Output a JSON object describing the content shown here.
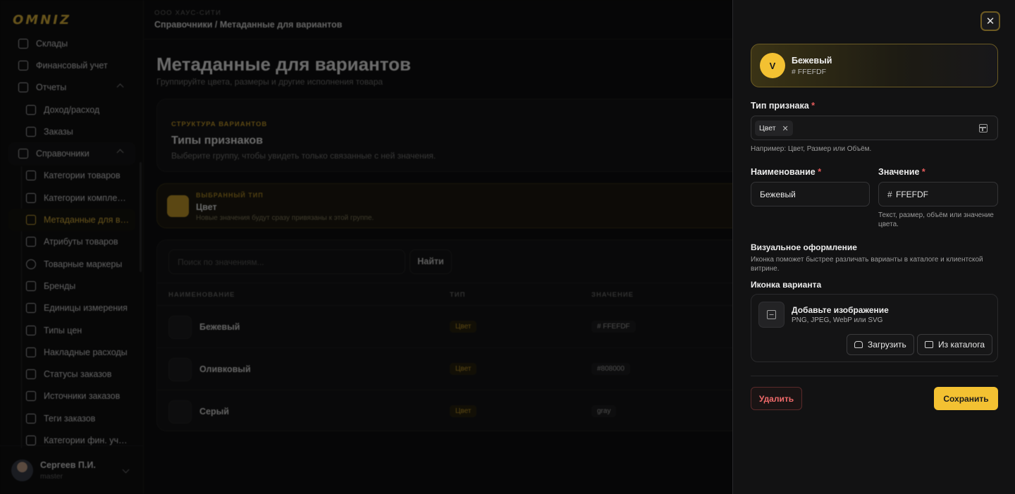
{
  "app": {
    "logo": "OMNIZ",
    "company": "ООО ХАУС-СИТИ",
    "breadcrumb": "Справочники / Метаданные для вариантов"
  },
  "sidebar": {
    "items": [
      {
        "label": "Склады",
        "icon": "warehouse-icon"
      },
      {
        "label": "Финансовый учет",
        "icon": "finance-icon"
      },
      {
        "label": "Отчеты",
        "icon": "reports-icon"
      },
      {
        "label": "Доход/расход",
        "icon": "bank-icon"
      },
      {
        "label": "Заказы",
        "icon": "box-icon"
      },
      {
        "label": "Справочники",
        "icon": "book-icon"
      },
      {
        "label": "Категории товаров",
        "icon": "tree-icon"
      },
      {
        "label": "Категории компле…",
        "icon": "hierarchy-icon"
      },
      {
        "label": "Метаданные для в…",
        "icon": "sliders-icon"
      },
      {
        "label": "Атрибуты товаров",
        "icon": "document-icon"
      },
      {
        "label": "Товарные маркеры",
        "icon": "circle-icon"
      },
      {
        "label": "Бренды",
        "icon": "bookmark-icon"
      },
      {
        "label": "Единицы измерения",
        "icon": "ruler-icon"
      },
      {
        "label": "Типы цен",
        "icon": "price-icon"
      },
      {
        "label": "Накладные расходы",
        "icon": "invoice-icon"
      },
      {
        "label": "Статусы заказов",
        "icon": "status-icon"
      },
      {
        "label": "Источники заказов",
        "icon": "signpost-icon"
      },
      {
        "label": "Теги заказов",
        "icon": "tag-icon"
      },
      {
        "label": "Категории фин. уч…",
        "icon": "folder-icon"
      }
    ],
    "user": {
      "name": "Сергеев П.И.",
      "role": "master"
    }
  },
  "page": {
    "title": "Метаданные для вариантов",
    "subtitle": "Группируйте цвета, размеры и другие исполнения товара",
    "structure": {
      "tag": "СТРУКТУРА ВАРИАНТОВ",
      "title": "Типы признаков",
      "subtitle": "Выберите группу, чтобы увидеть только связанные с ней значения."
    },
    "selected_type": {
      "tag": "ВЫБРАННЫЙ ТИП",
      "title": "Цвет",
      "subtitle": "Новые значения будут сразу привязаны к этой группе."
    },
    "search": {
      "placeholder": "Поиск по значениям...",
      "button": "Найти"
    },
    "table": {
      "columns": [
        "НАИМЕНОВАНИЕ",
        "ТИП",
        "ЗНАЧЕНИЕ"
      ],
      "rows": [
        {
          "name": "Бежевый",
          "type": "Цвет",
          "value": "# FFEFDF"
        },
        {
          "name": "Оливковый",
          "type": "Цвет",
          "value": "#808000"
        },
        {
          "name": "Серый",
          "type": "Цвет",
          "value": "gray"
        }
      ]
    }
  },
  "drawer": {
    "preview": {
      "badge": "V",
      "name": "Бежевый",
      "hex": "# FFEFDF"
    },
    "type_label": "Тип признака",
    "required_mark": "*",
    "type_chip": "Цвет",
    "type_hint": "Например: Цвет, Размер или Объём.",
    "name_label": "Наименование",
    "name_value": "Бежевый",
    "value_label": "Значение",
    "value_prefix": "#",
    "value_value": "FFEFDF",
    "value_hint": "Текст, размер, объём или значение цвета.",
    "visual_title": "Визуальное оформление",
    "visual_sub": "Иконка поможет быстрее различать варианты в каталоге и клиентской витрине.",
    "icon_label": "Иконка варианта",
    "upload_title": "Добавьте изображение",
    "upload_formats": "PNG, JPEG, WebP или SVG",
    "upload_button": "Загрузить",
    "catalog_button": "Из каталога",
    "delete_button": "Удалить",
    "save_button": "Сохранить"
  },
  "colors": {
    "accent": "#f3c132",
    "danger": "#ef6a6a",
    "background": "#0d0d0e"
  }
}
